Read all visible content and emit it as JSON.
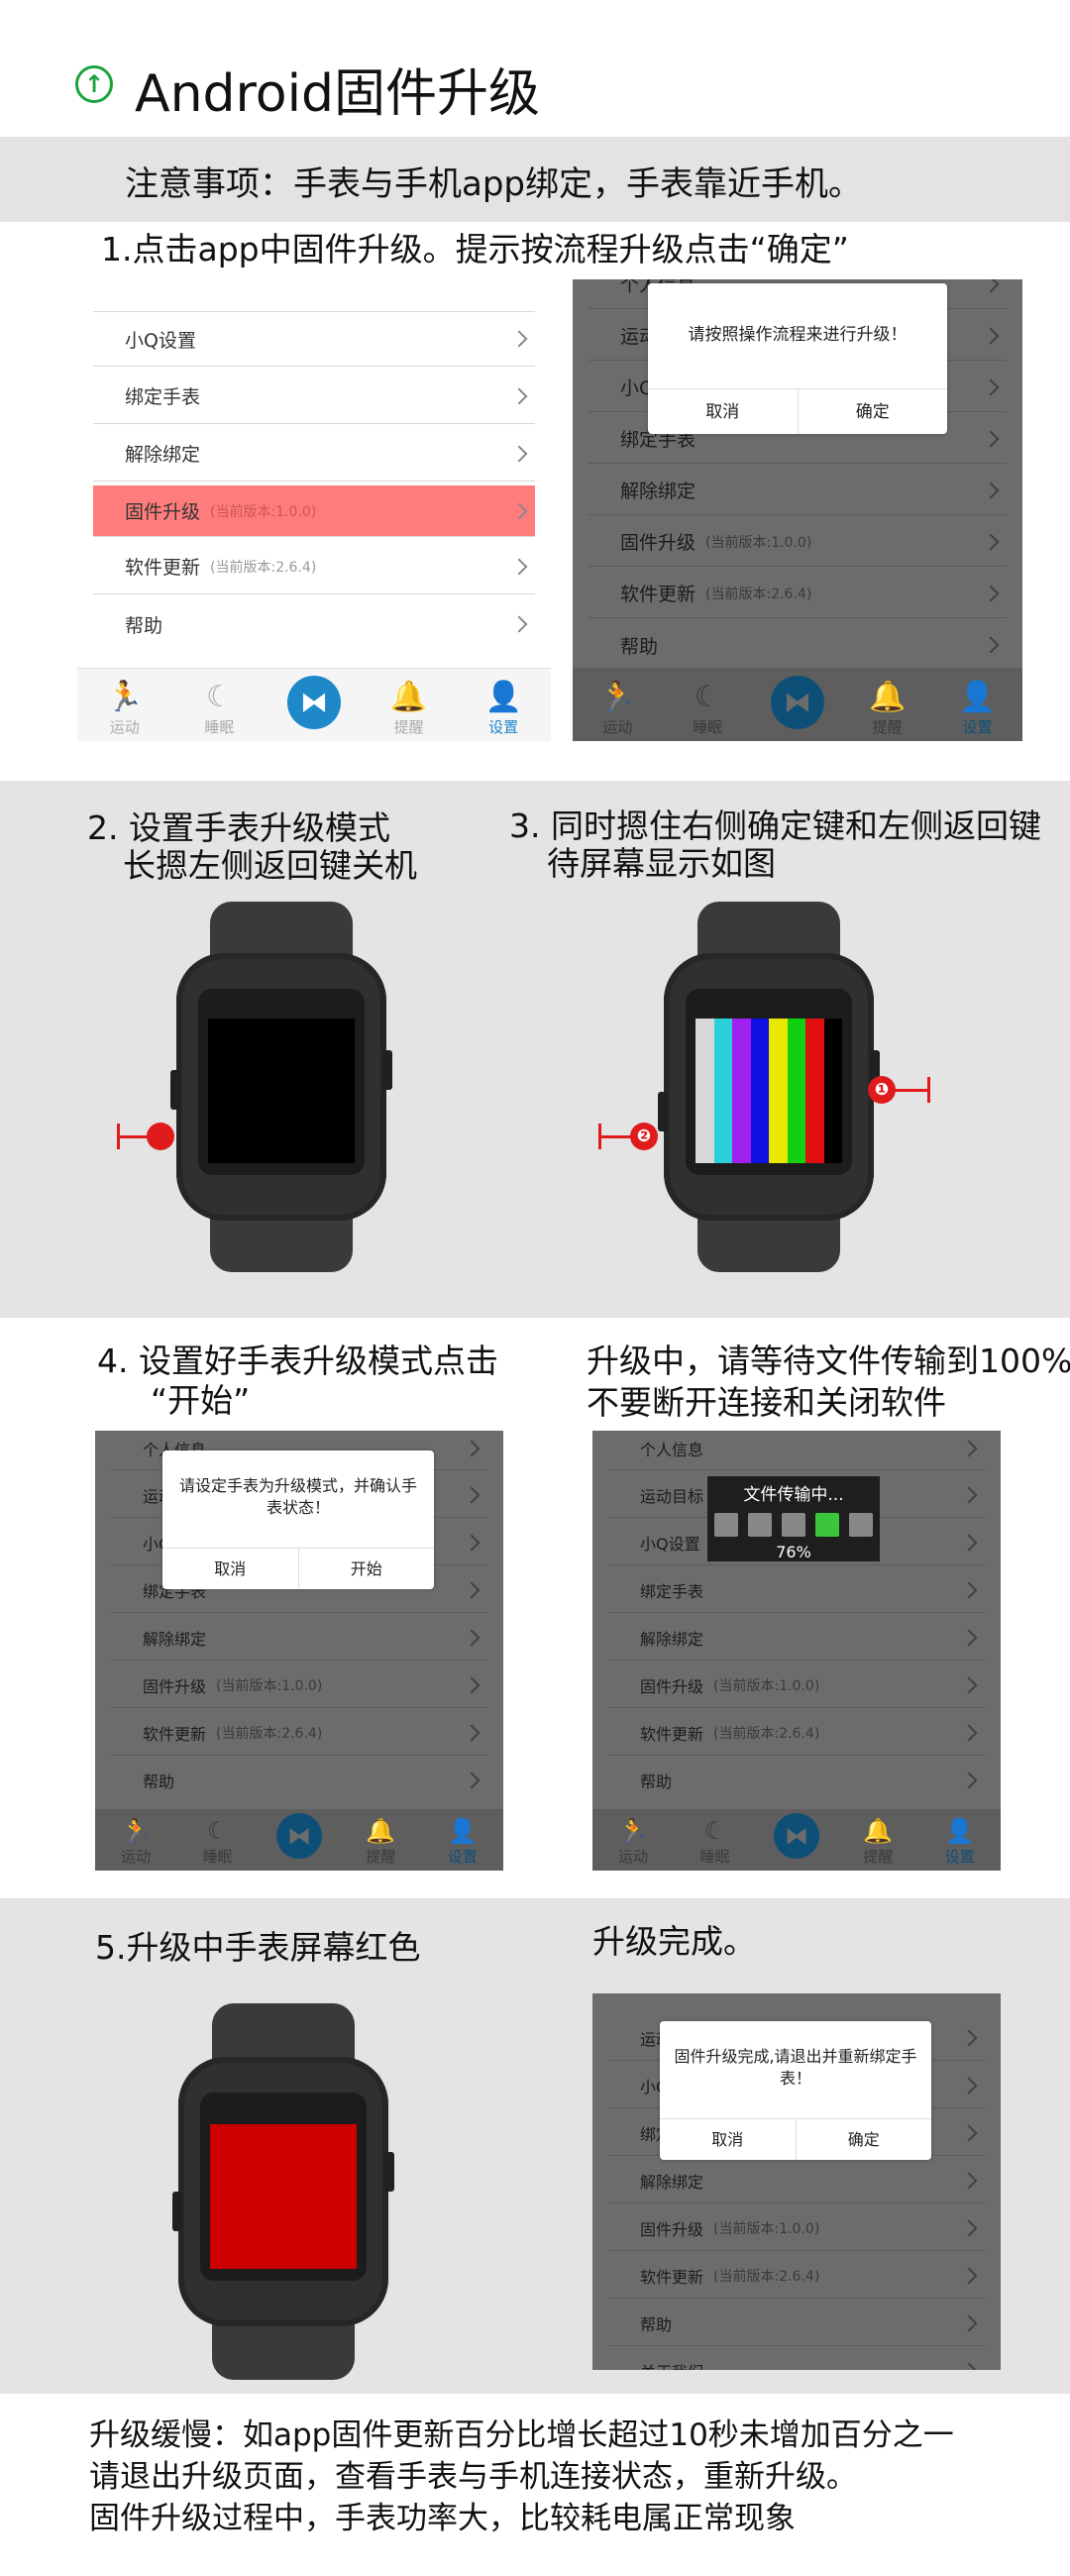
{
  "title": "Android固件升级",
  "notice": "注意事项：手表与手机app绑定，手表靠近手机。",
  "step1": "1.点击app中固件升级。提示按流程升级点击“确定”",
  "step2_line1": "2. 设置手表升级模式",
  "step2_line2": "长摁左侧返回键关机",
  "step3_line1": "3. 同时摁住右侧确定键和左侧返回键",
  "step3_line2": "待屏幕显示如图",
  "step4_line1": "4.  设置好手表升级模式点击",
  "step4_line2": "“开始”",
  "upgrading_line1": "升级中，请等待文件传输到100%",
  "upgrading_line2": "不要断开连接和关闭软件",
  "step5": "5.升级中手表屏幕红色",
  "done": "升级完成。",
  "footer": {
    "line1": "升级缓慢：如app固件更新百分比增长超过10秒未增加百分之一",
    "line2": "请退出升级页面，查看手表与手机连接状态，重新升级。",
    "line3": "固件升级过程中，手表功率大，比较耗电属正常现象"
  },
  "menu": {
    "personal_info": "个人信息",
    "sport_goal": "运动目标",
    "xiaoq_settings": "小Q设置",
    "bind_watch": "绑定手表",
    "unbind": "解除绑定",
    "firmware_upgrade": "固件升级",
    "firmware_version": "(当前版本:1.0.0)",
    "software_update": "软件更新",
    "software_version": "(当前版本:2.6.4)",
    "help": "帮助",
    "about_us": "关于我们"
  },
  "tabs": {
    "sport": "运动",
    "sleep": "睡眠",
    "remind": "提醒",
    "settings": "设置"
  },
  "dialogs": {
    "confirm_msg": "请按照操作流程来进行升级！",
    "start_msg": "请设定手表为升级模式，并确认手表状态！",
    "done_msg": "固件升级完成,请退出并重新绑定手表！",
    "cancel": "取消",
    "ok": "确定",
    "start": "开始"
  },
  "transfer": {
    "title": "文件传输中...",
    "percent": "76%"
  },
  "markers": {
    "one": "❶",
    "two": "❷"
  },
  "colors": {
    "highlight": "#ff7c7c",
    "accent_blue": "#1e88c9",
    "upgrade_red": "#cc0000",
    "title_icon_green": "#1aa33a"
  }
}
